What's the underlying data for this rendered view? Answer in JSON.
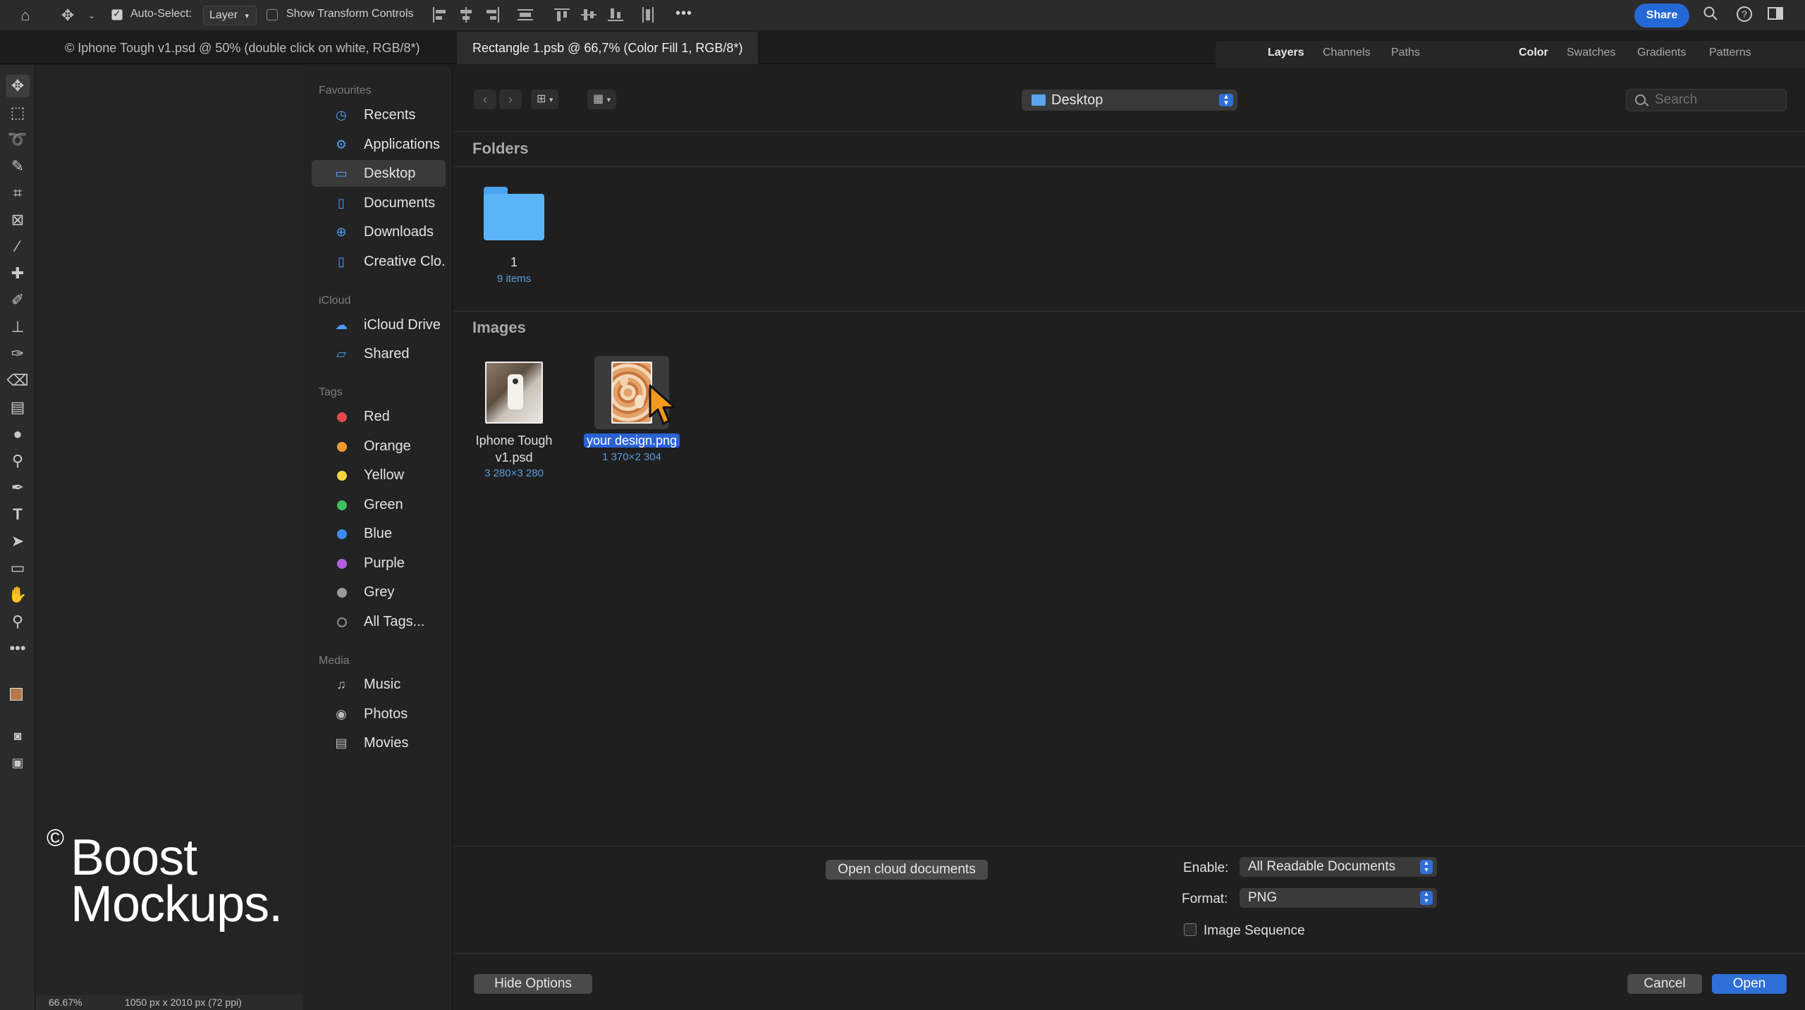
{
  "optionbar": {
    "auto_select_label": "Auto-Select:",
    "auto_select_target": "Layer",
    "auto_select_checked": true,
    "show_transform_label": "Show Transform Controls",
    "show_transform_checked": false,
    "more_label": "•••",
    "share_label": "Share"
  },
  "document_tabs": [
    {
      "label": "© Iphone Tough v1.psd @ 50% (double click on white, RGB/8*)",
      "active": false
    },
    {
      "label": "Rectangle 1.psb @ 66,7% (Color Fill 1, RGB/8*)",
      "active": true
    }
  ],
  "panel_tabs_left": [
    "Layers",
    "Channels",
    "Paths"
  ],
  "panel_tabs_right": [
    "Color",
    "Swatches",
    "Gradients",
    "Patterns"
  ],
  "status": {
    "zoom": "66.67%",
    "doc_info": "1050 px x 2010 px (72 ppi)"
  },
  "watermark": {
    "copyright": "©",
    "line1": "Boost",
    "line2": "Mockups."
  },
  "sidebar": {
    "favourites_title": "Favourites",
    "favourites": [
      {
        "label": "Recents",
        "icon": "clock-icon"
      },
      {
        "label": "Applications",
        "icon": "applications-icon"
      },
      {
        "label": "Desktop",
        "icon": "desktop-icon",
        "selected": true
      },
      {
        "label": "Documents",
        "icon": "document-icon"
      },
      {
        "label": "Downloads",
        "icon": "download-icon"
      },
      {
        "label": "Creative Clo...",
        "icon": "document-icon"
      }
    ],
    "icloud_title": "iCloud",
    "icloud": [
      {
        "label": "iCloud Drive",
        "icon": "cloud-icon"
      },
      {
        "label": "Shared",
        "icon": "shared-folder-icon"
      }
    ],
    "tags_title": "Tags",
    "tags": [
      {
        "label": "Red",
        "color": "#e5484d"
      },
      {
        "label": "Orange",
        "color": "#f2992e"
      },
      {
        "label": "Yellow",
        "color": "#f5d440"
      },
      {
        "label": "Green",
        "color": "#3fbf5d"
      },
      {
        "label": "Blue",
        "color": "#3a8cf0"
      },
      {
        "label": "Purple",
        "color": "#b65ee0"
      },
      {
        "label": "Grey",
        "color": "#9a9a9a"
      },
      {
        "label": "All Tags...",
        "color": ""
      }
    ],
    "media_title": "Media",
    "media": [
      {
        "label": "Music",
        "icon": "music-icon"
      },
      {
        "label": "Photos",
        "icon": "camera-icon"
      },
      {
        "label": "Movies",
        "icon": "film-icon"
      }
    ]
  },
  "browser": {
    "location": "Desktop",
    "search_placeholder": "Search",
    "folders_title": "Folders",
    "folders": [
      {
        "name": "1",
        "meta": "9 items"
      }
    ],
    "images_title": "Images",
    "images": [
      {
        "name_line1": "Iphone Tough",
        "name_line2": "v1.psd",
        "meta": "3 280×3 280"
      },
      {
        "name_line1": "your design.png",
        "meta": "1 370×2 304",
        "selected": true
      }
    ]
  },
  "options": {
    "open_cloud_label": "Open cloud documents",
    "enable_label": "Enable:",
    "enable_value": "All Readable Documents",
    "format_label": "Format:",
    "format_value": "PNG",
    "image_sequence_label": "Image Sequence",
    "image_sequence_checked": false,
    "hide_options_label": "Hide Options",
    "cancel_label": "Cancel",
    "open_label": "Open"
  }
}
